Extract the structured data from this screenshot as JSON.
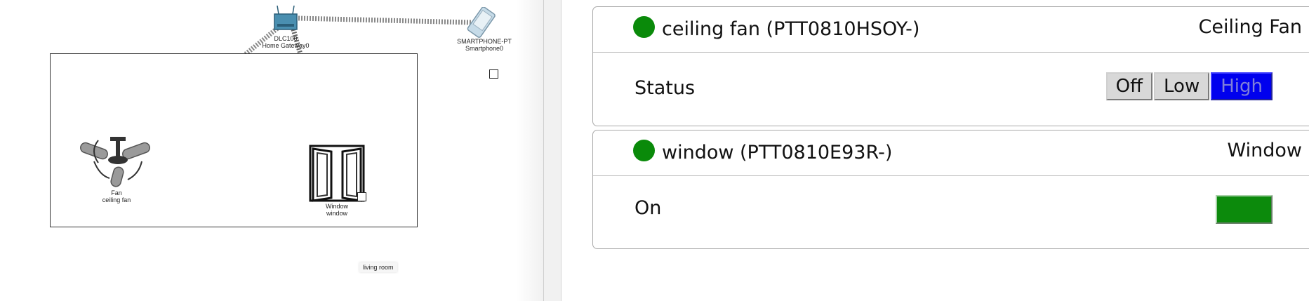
{
  "workspace": {
    "gateway_label_model": "DLC100",
    "gateway_label_name": "Home Gateway0",
    "phone_label_model": "SMARTPHONE-PT",
    "phone_label_name": "Smartphone0",
    "fan_label_type": "Fan",
    "fan_label_name": "ceiling fan",
    "window_label_type": "Window",
    "window_label_name": "window",
    "room_label": "living room"
  },
  "devices": [
    {
      "title": "ceiling fan (PTT0810HSOY-)",
      "type": "Ceiling Fan",
      "status_led": "on",
      "row_label": "Status",
      "options": [
        "Off",
        "Low",
        "High"
      ],
      "selected": "High"
    },
    {
      "title": "window (PTT0810E93R-)",
      "type": "Window",
      "status_led": "on",
      "row_label": "On",
      "toggle_state": "on"
    }
  ],
  "colors": {
    "led_green": "#0a8a0a",
    "active_button": "#0000ee",
    "toggle_on": "#0c8a0c"
  }
}
